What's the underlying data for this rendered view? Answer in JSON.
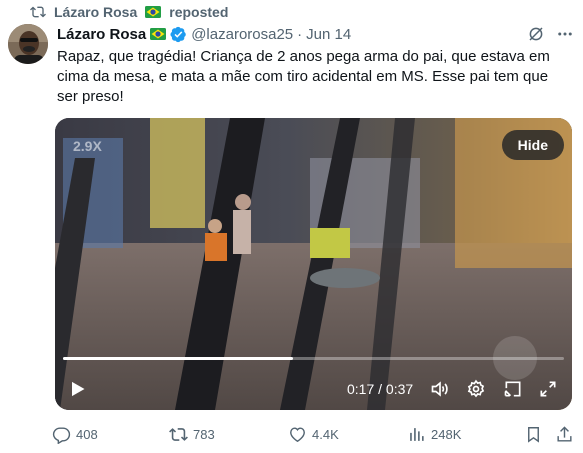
{
  "repost": {
    "label": "Lázaro Rosa",
    "suffix": "reposted"
  },
  "tweet": {
    "author_name": "Lázaro Rosa",
    "handle": "@lazarorosa25",
    "separator": "·",
    "date": "Jun 14",
    "text": "Rapaz, que tragédia! Criança de 2 anos pega arma do pai, que estava em cima da mesa, e mata a mãe com tiro acidental em MS. Esse pai tem que ser preso!"
  },
  "video": {
    "hide_label": "Hide",
    "overlay_text": "2.9X",
    "time": "0:17 / 0:37",
    "progress": 0.46
  },
  "actions": {
    "replies": "408",
    "reposts": "783",
    "likes": "4.4K",
    "views": "248K"
  },
  "colors": {
    "accent": "#1d9bf0",
    "muted": "#536471",
    "text": "#0f1419"
  },
  "icons": [
    "repost-icon",
    "brazil-flag-icon",
    "verified-badge-icon",
    "grok-icon",
    "more-icon",
    "play-icon",
    "volume-icon",
    "settings-icon",
    "picture-in-picture-icon",
    "fullscreen-icon",
    "reply-icon",
    "like-icon",
    "views-icon",
    "bookmark-icon",
    "share-icon"
  ]
}
